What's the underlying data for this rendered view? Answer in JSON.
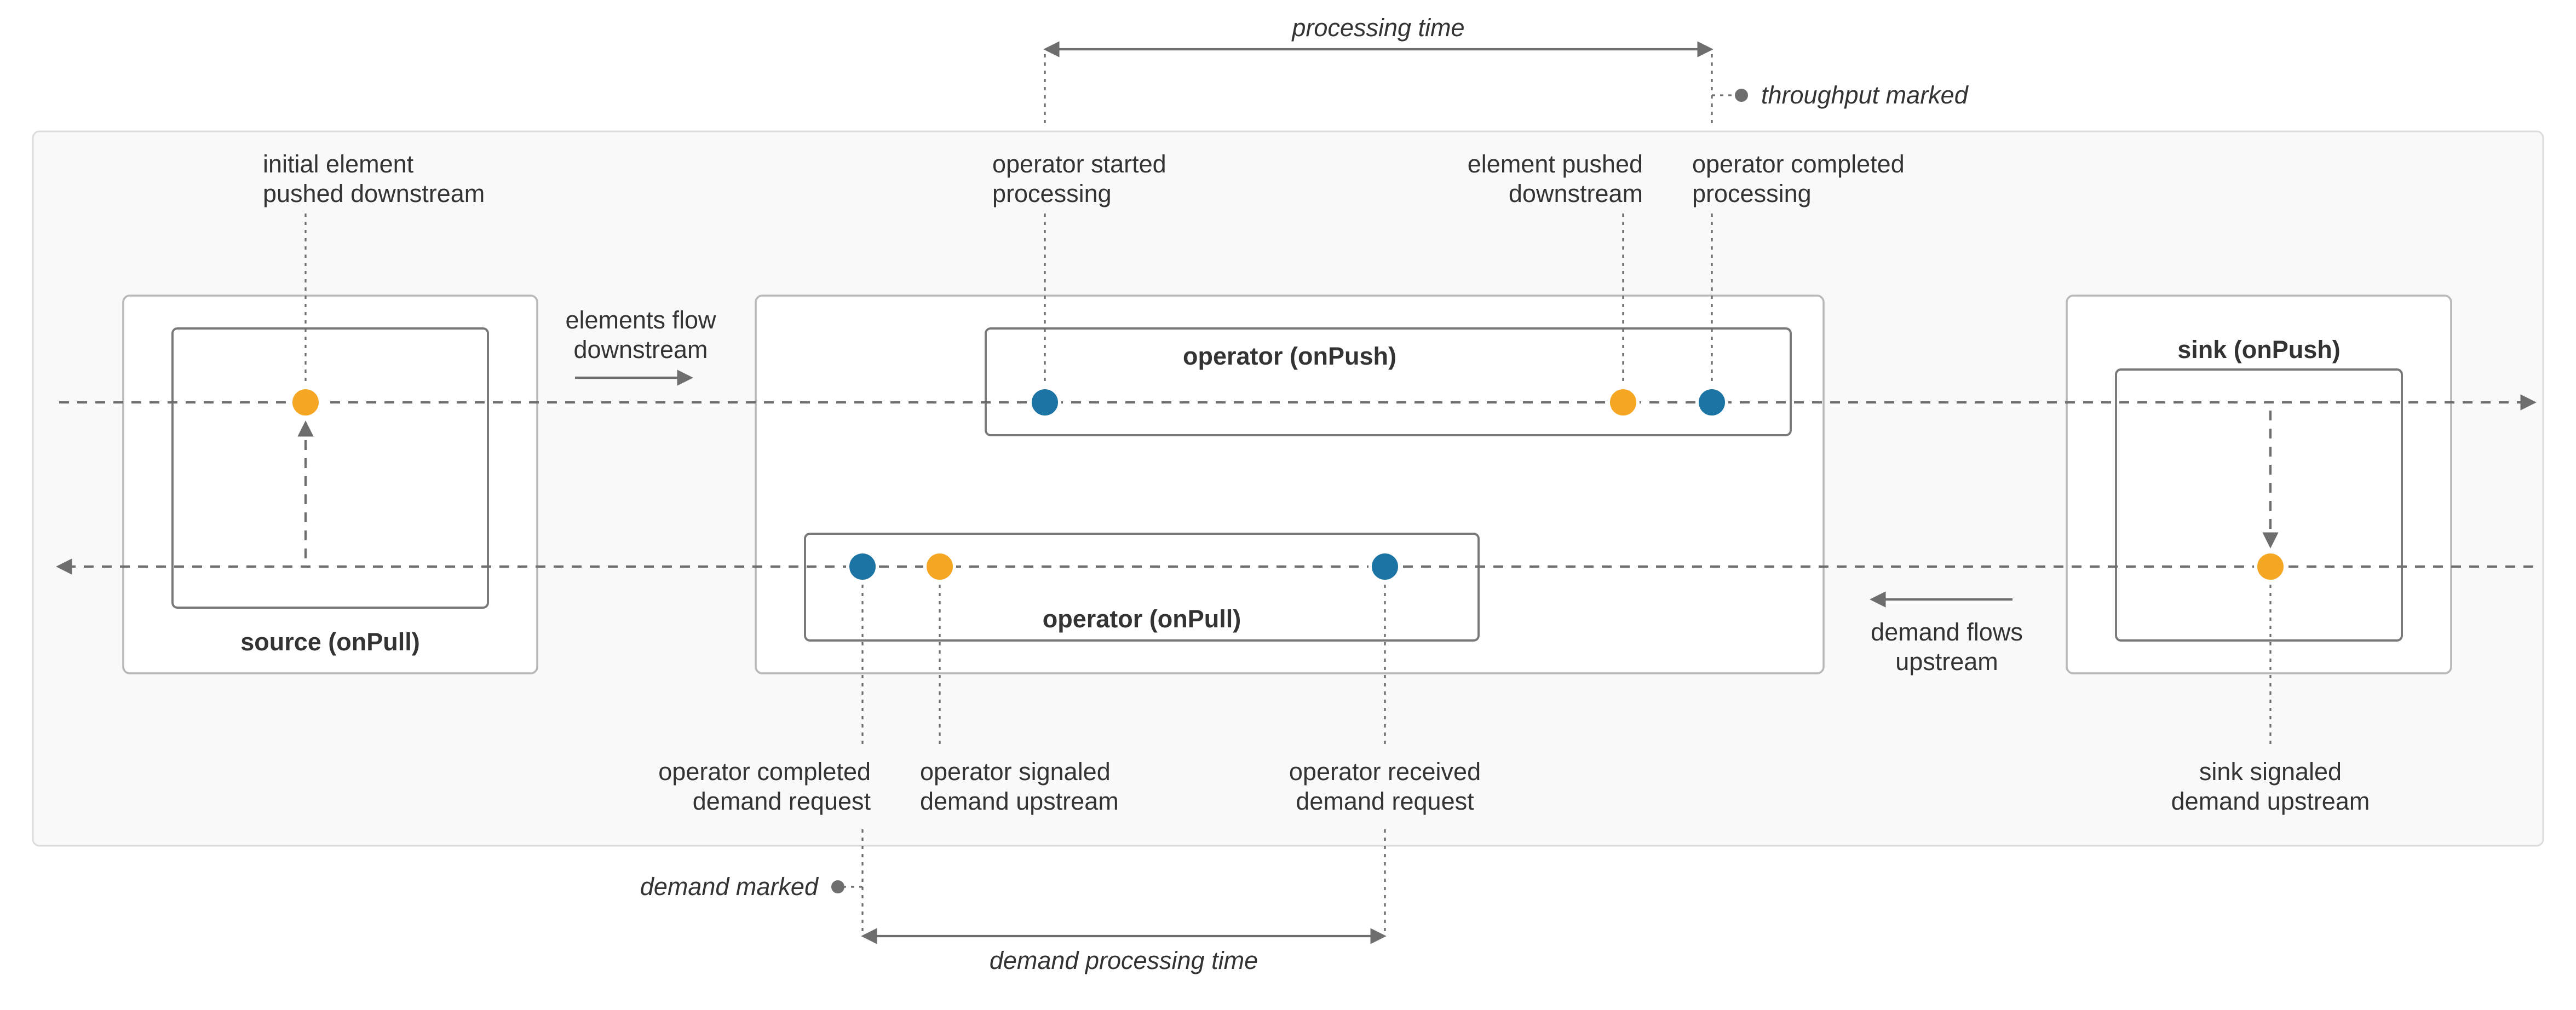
{
  "outer": {
    "source_title": "source (onPull)",
    "operator_push_title": "operator (onPush)",
    "operator_pull_title": "operator (onPull)",
    "sink_title": "sink (onPush)"
  },
  "flow": {
    "elements_flow_1": "elements flow",
    "elements_flow_2": "downstream",
    "demand_flow_1": "demand flows",
    "demand_flow_2": "upstream"
  },
  "labels": {
    "initial_1": "initial element",
    "initial_2": "pushed downstream",
    "op_started_1": "operator started",
    "op_started_2": "processing",
    "elem_pushed_1": "element pushed",
    "elem_pushed_2": "downstream",
    "op_completed_1": "operator completed",
    "op_completed_2": "processing",
    "op_comp_demand_1": "operator completed",
    "op_comp_demand_2": "demand request",
    "op_sig_demand_1": "operator signaled",
    "op_sig_demand_2": "demand upstream",
    "op_recv_demand_1": "operator received",
    "op_recv_demand_2": "demand request",
    "sink_sig_1": "sink signaled",
    "sink_sig_2": "demand upstream"
  },
  "metrics": {
    "processing_time": "processing time",
    "throughput_marked": "throughput marked",
    "demand_marked": "demand marked",
    "demand_processing_time": "demand processing time"
  },
  "colors": {
    "orange": "#f5a623",
    "blue": "#1b74a3",
    "gray": "#6e6e6e"
  }
}
